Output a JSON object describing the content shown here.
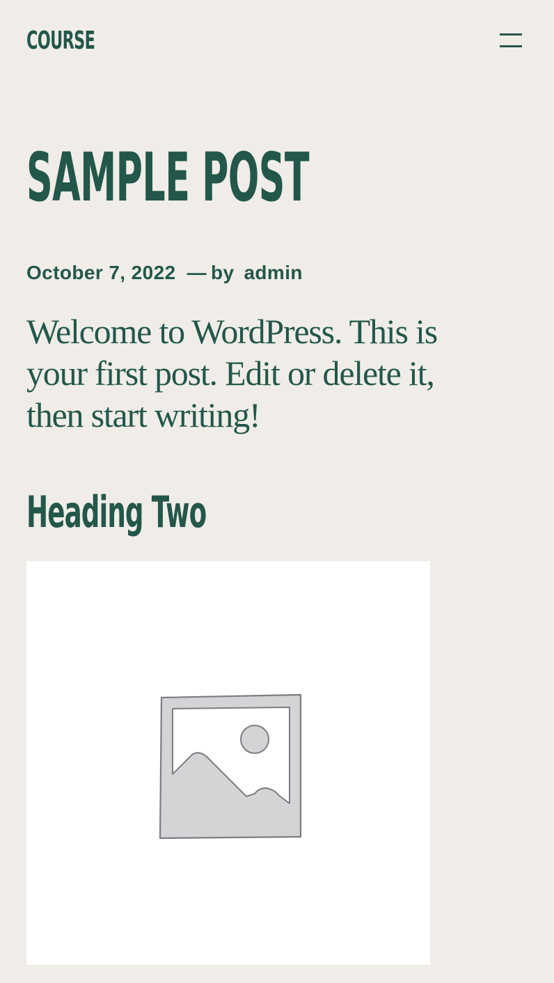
{
  "header": {
    "site_title": "COURSE",
    "menu_icon": "hamburger-menu-icon"
  },
  "post": {
    "title": "SAMPLE POST",
    "date": "October 7, 2022",
    "separator": "—",
    "by_label": "by",
    "author": "admin",
    "body": "Welcome to WordPress. This is your first post. Edit or delete it, then start writing!",
    "heading_two": "Heading Two",
    "image_icon": "image-placeholder-icon"
  },
  "colors": {
    "background": "#f0ede8",
    "primary_text": "#23574a",
    "image_background": "#ffffff",
    "placeholder_gray": "#d4d4d6",
    "placeholder_outline": "#8a8a8e"
  }
}
